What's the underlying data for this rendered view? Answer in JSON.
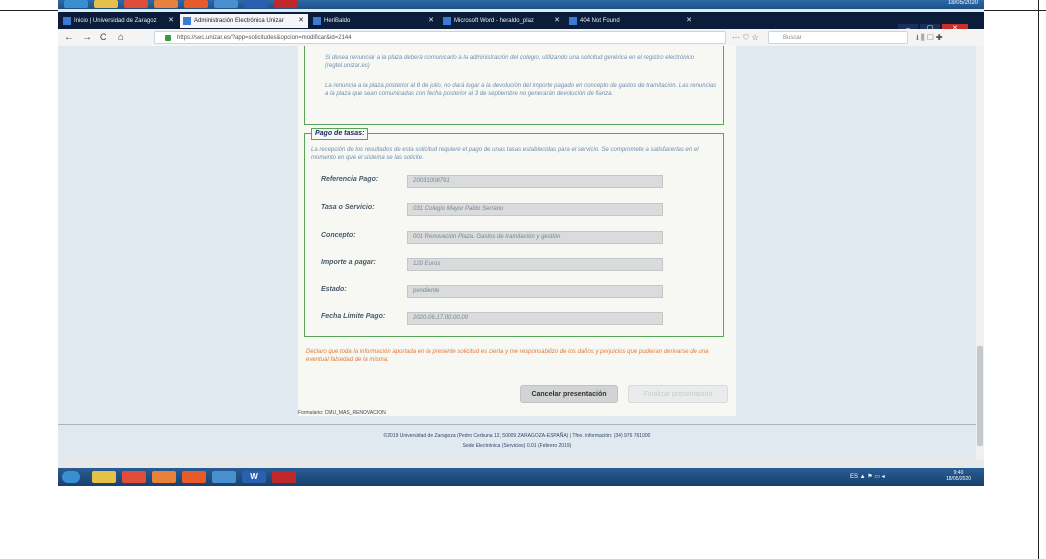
{
  "top_taskbar": {
    "clock": "18/05/2020"
  },
  "tabs": [
    {
      "label": "Inicio | Universidad de Zaragoz",
      "active": false
    },
    {
      "label": "Administración Electrónica Unizar",
      "active": true
    },
    {
      "label": "HeriBaldo",
      "active": false
    },
    {
      "label": "Microsoft Word - heraldo_plaz",
      "active": false
    },
    {
      "label": "404 Not Found",
      "active": false
    }
  ],
  "nav": {
    "back": "←",
    "forward": "→",
    "reload": "C",
    "home": "⌂",
    "url": "https://sec.unizar.es/?app=solicitudes&opcion=modificar&id=2144",
    "more": "··· ♡ ☆",
    "search_placeholder": "Buscar",
    "tools": "⭳ ⫼ ▢ ✚"
  },
  "top_panel": {
    "paragraph1": "Si desea renunciar a la plaza deberá comunicarlo a la administración del colegio, utilizando una solicitud genérica en el registro electrónico (regtel.unizar.es)",
    "paragraph2": "La renuncia a la plaza posterior al 8 de julio, no dará lugar a la devolución del importe pagado en concepto de gastos de tramitación. Las renuncias a la plaza que sean comunicadas con fecha posterior al 3 de septiembre no generarán devolución de fianza."
  },
  "payment": {
    "legend": "Pago de tasas:",
    "intro": "La recepción de los resultados de esta solicitud requiere el pago de unas tasas establecidas para el servicio. Se compromete a satisfacerlas en el momento en que el sistema se las solicite.",
    "fields": [
      {
        "label": "Referencia Pago:",
        "value": "20031008791"
      },
      {
        "label": "Tasa o Servicio:",
        "value": "031 Colegio Mayor Pablo Serrano"
      },
      {
        "label": "Concepto:",
        "value": "001 Renovación Plaza. Gastos de tramitación y gestión"
      },
      {
        "label": "Importe a pagar:",
        "value": "120 Euros"
      },
      {
        "label": "Estado:",
        "value": "pendiente"
      },
      {
        "label": "Fecha Límite Pago:",
        "value": "2020.06.17.00.00.00"
      }
    ]
  },
  "declaration": "Declaro que toda la información aportada en la presente solicitud es cierta y me responsabilizo de los daños y perjuicios que pudieran derivarse de una eventual falsedad de la misma.",
  "buttons": {
    "cancel": "Cancelar presentación",
    "present": "Finalizar presentación"
  },
  "formulario": "Formulario: CMU_MAS_RENOVACION",
  "footer": {
    "line1": "©2019 Universidad de Zaragoza (Pedro Cerbuna 12, 50009 ZARAGOZA-ESPAÑA) | Tfno. información: (34) 976 761000",
    "line2": "Sede Electrónica (Servicios) 0.01 (Febrero 2019)"
  },
  "taskbar": {
    "tray": "ES ▲ ⚑ ▭ ◂",
    "time": "9:40",
    "date": "18/05/2020"
  },
  "colors": {
    "accent_green": "#5aa45a",
    "warning_orange": "#e07a3a",
    "taskbar_blue": "#1d4f86"
  }
}
